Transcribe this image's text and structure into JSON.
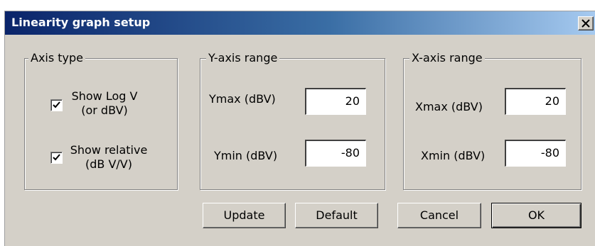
{
  "window": {
    "title": "Linearity graph setup",
    "close_glyph": "X"
  },
  "axis_type": {
    "title": "Axis type",
    "show_log": {
      "line1": "Show Log V",
      "line2": "(or dBV)",
      "checked": true
    },
    "show_relative": {
      "line1": "Show relative",
      "line2": "(dB V/V)",
      "checked": true
    }
  },
  "y_axis": {
    "title": "Y-axis range",
    "max_label": "Ymax (dBV)",
    "max_value": "20",
    "min_label": "Ymin (dBV)",
    "min_value": "-80"
  },
  "x_axis": {
    "title": "X-axis range",
    "max_label": "Xmax (dBV)",
    "max_value": "20",
    "min_label": "Xmin (dBV)",
    "min_value": "-80"
  },
  "buttons": {
    "update": "Update",
    "default": "Default",
    "cancel": "Cancel",
    "ok": "OK"
  },
  "colors": {
    "title_gradient_start": "#0a246a",
    "title_gradient_end": "#a6caf0",
    "face": "#d4d0c8"
  }
}
